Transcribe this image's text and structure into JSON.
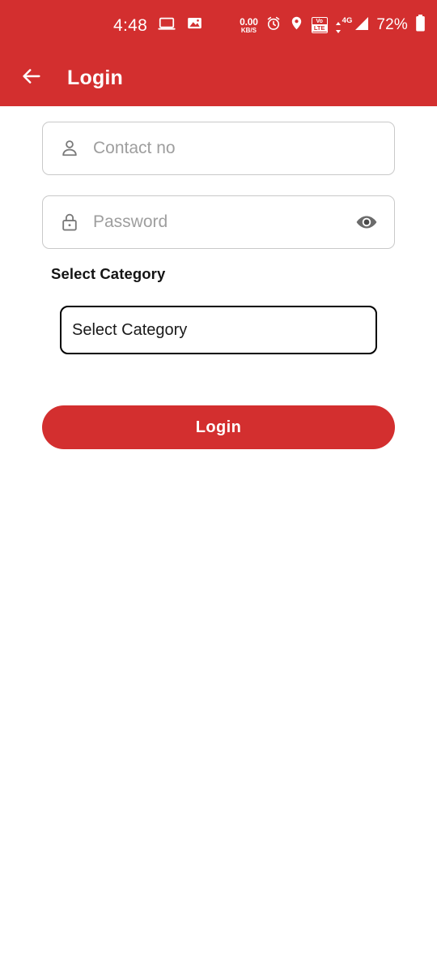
{
  "theme": {
    "primary": "#D32F2F",
    "background": "#FFFFFF",
    "placeholder_color": "#9E9E9E",
    "border_color": "#C9C9C9",
    "dropdown_border": "#000000"
  },
  "status_bar": {
    "time": "4:48",
    "cast_icon": "laptop-screencast-icon",
    "photo_icon": "image-icon",
    "network_speed_value": "0.00",
    "network_speed_unit": "KB/S",
    "alarm_icon": "alarm-clock-icon",
    "location_icon": "location-pin-icon",
    "volte_top": "Vo",
    "volte_bottom": "LTE",
    "data_arrows": "▲▼",
    "network_generation": "4G",
    "signal_icon": "signal-bars-icon",
    "battery_percent": "72%",
    "battery_icon": "battery-icon"
  },
  "app_bar": {
    "back_icon": "back-arrow-icon",
    "title": "Login"
  },
  "form": {
    "contact": {
      "icon": "person-icon",
      "placeholder": "Contact no",
      "value": ""
    },
    "password": {
      "icon": "lock-icon",
      "placeholder": "Password",
      "value": "",
      "toggle_icon": "eye-visibility-icon"
    },
    "category": {
      "label": "Select Category",
      "selected": "Select Category"
    },
    "submit_label": "Login"
  }
}
